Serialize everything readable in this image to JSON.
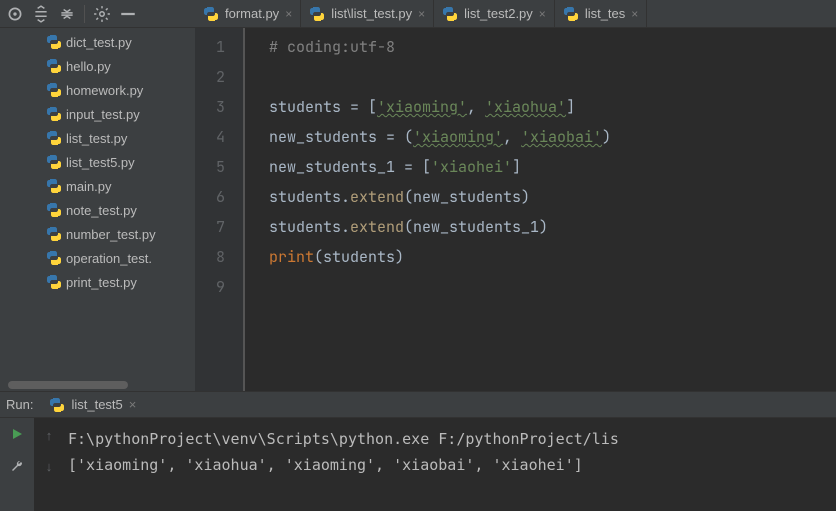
{
  "sidebar": {
    "files": [
      {
        "name": "dict_test.py"
      },
      {
        "name": "hello.py"
      },
      {
        "name": "homework.py"
      },
      {
        "name": "input_test.py"
      },
      {
        "name": "list_test.py"
      },
      {
        "name": "list_test5.py"
      },
      {
        "name": "main.py"
      },
      {
        "name": "note_test.py"
      },
      {
        "name": "number_test.py"
      },
      {
        "name": "operation_test."
      },
      {
        "name": "print_test.py"
      }
    ]
  },
  "tabs": [
    {
      "label": "format.py"
    },
    {
      "label": "list\\list_test.py"
    },
    {
      "label": "list_test2.py"
    },
    {
      "label": "list_tes"
    }
  ],
  "code": {
    "lines": [
      "1",
      "2",
      "3",
      "4",
      "5",
      "6",
      "7",
      "8",
      "9"
    ],
    "l1_comment": "# coding:utf-8",
    "l3_a": "students = [",
    "l3_s1": "'xiaoming'",
    "l3_c": ", ",
    "l3_s2": "'xiaohua'",
    "l3_b": "]",
    "l4_a": "new_students = (",
    "l4_s1": "'xiaoming'",
    "l4_c": ", ",
    "l4_s2": "'xiaobai'",
    "l4_b": ")",
    "l5_a": "new_students_1 = [",
    "l5_s1": "'xiaohei'",
    "l5_b": "]",
    "l6_a": "students.",
    "l6_fn": "extend",
    "l6_b": "(new_students)",
    "l7_a": "students.",
    "l7_fn": "extend",
    "l7_b": "(new_students_1)",
    "l8_fn": "print",
    "l8_b": "(students)"
  },
  "run": {
    "label": "Run:",
    "tab": "list_test5",
    "out1": "F:\\pythonProject\\venv\\Scripts\\python.exe F:/pythonProject/lis",
    "out2": "['xiaoming', 'xiaohua', 'xiaoming', 'xiaobai', 'xiaohei']"
  }
}
